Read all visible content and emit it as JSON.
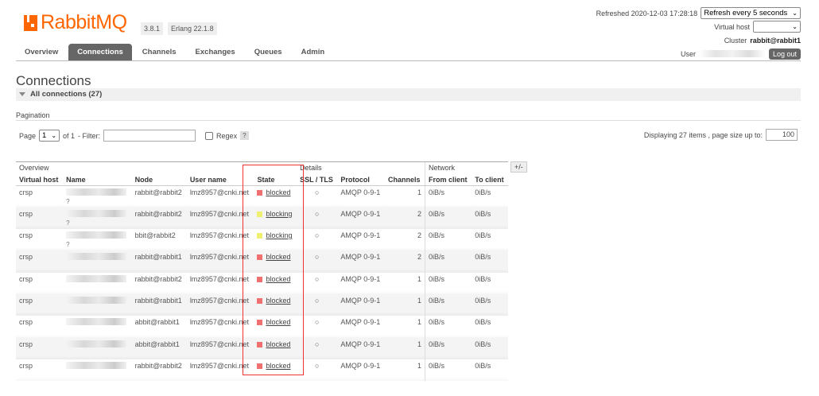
{
  "app": {
    "logo_text": "RabbitMQ",
    "version": "3.8.1",
    "erlang": "Erlang 22.1.8"
  },
  "header": {
    "refreshed": "Refreshed 2020-12-03 17:28:18",
    "refresh_option": "Refresh every 5 seconds",
    "virtual_host_label": "Virtual host",
    "virtual_host_value": "",
    "cluster_label": "Cluster",
    "cluster_value": "rabbit@rabbit1",
    "user_label": "User",
    "logout_label": "Log out"
  },
  "nav": {
    "items": [
      "Overview",
      "Connections",
      "Channels",
      "Exchanges",
      "Queues",
      "Admin"
    ],
    "active": "Connections"
  },
  "page": {
    "title": "Connections",
    "section": "All connections (27)"
  },
  "pagination": {
    "label": "Pagination",
    "page_label": "Page",
    "page_value": "1",
    "of_label": "of 1",
    "filter_label": "- Filter:",
    "filter_value": "",
    "regex_label": "Regex",
    "help": "?",
    "displaying": "Displaying 27 items , page size up to:",
    "page_size": "100"
  },
  "table": {
    "groups": [
      "Overview",
      "Details",
      "Network"
    ],
    "columns": [
      "Virtual host",
      "Name",
      "Node",
      "User name",
      "State",
      "SSL / TLS",
      "Protocol",
      "Channels",
      "From client",
      "To client"
    ],
    "toggle": "+/-",
    "rows": [
      {
        "vhost": "crsp",
        "name_suffix": "?",
        "node": "rabbit@rabbit2",
        "user": "lmz8957@cnki.net",
        "state": "blocked",
        "state_color": "#f07070",
        "ssl": "○",
        "protocol": "AMQP 0-9-1",
        "channels": "1",
        "from": "0iB/s",
        "to": "0iB/s"
      },
      {
        "vhost": "crsp",
        "name_suffix": "?",
        "node": "rabbit@rabbit2",
        "user": "lmz8957@cnki.net",
        "state": "blocking",
        "state_color": "#f0f070",
        "ssl": "○",
        "protocol": "AMQP 0-9-1",
        "channels": "2",
        "from": "0iB/s",
        "to": "0iB/s"
      },
      {
        "vhost": "crsp",
        "name_suffix": "?",
        "node": "bbit@rabbit2",
        "user": "lmz8957@cnki.net",
        "state": "blocking",
        "state_color": "#f0f070",
        "ssl": "○",
        "protocol": "AMQP 0-9-1",
        "channels": "2",
        "from": "0iB/s",
        "to": "0iB/s"
      },
      {
        "vhost": "crsp",
        "name_suffix": "",
        "node": "rabbit@rabbit1",
        "user": "lmz8957@cnki.net",
        "state": "blocked",
        "state_color": "#f07070",
        "ssl": "○",
        "protocol": "AMQP 0-9-1",
        "channels": "2",
        "from": "0iB/s",
        "to": "0iB/s"
      },
      {
        "vhost": "crsp",
        "name_suffix": "",
        "node": "rabbit@rabbit2",
        "user": "lmz8957@cnki.net",
        "state": "blocked",
        "state_color": "#f07070",
        "ssl": "○",
        "protocol": "AMQP 0-9-1",
        "channels": "1",
        "from": "0iB/s",
        "to": "0iB/s"
      },
      {
        "vhost": "crsp",
        "name_suffix": "",
        "node": "rabbit@rabbit1",
        "user": "lmz8957@cnki.net",
        "state": "blocked",
        "state_color": "#f07070",
        "ssl": "○",
        "protocol": "AMQP 0-9-1",
        "channels": "1",
        "from": "0iB/s",
        "to": "0iB/s"
      },
      {
        "vhost": "crsp",
        "name_suffix": "",
        "node": "abbit@rabbit1",
        "user": "lmz8957@cnki.net",
        "state": "blocked",
        "state_color": "#f07070",
        "ssl": "○",
        "protocol": "AMQP 0-9-1",
        "channels": "1",
        "from": "0iB/s",
        "to": "0iB/s"
      },
      {
        "vhost": "crsp",
        "name_suffix": "",
        "node": "abbit@rabbit1",
        "user": "lmz8957@cnki.net",
        "state": "blocked",
        "state_color": "#f07070",
        "ssl": "○",
        "protocol": "AMQP 0-9-1",
        "channels": "1",
        "from": "0iB/s",
        "to": "0iB/s"
      },
      {
        "vhost": "crsp",
        "name_suffix": "",
        "node": "rabbit@rabbit2",
        "user": "lmz8957@cnki.net",
        "state": "blocked",
        "state_color": "#f07070",
        "ssl": "○",
        "protocol": "AMQP 0-9-1",
        "channels": "1",
        "from": "0iB/s",
        "to": "0iB/s"
      }
    ]
  },
  "colors": {
    "brand": "#ff6600",
    "nav_active": "#666666",
    "annotation": "#ee3333"
  }
}
